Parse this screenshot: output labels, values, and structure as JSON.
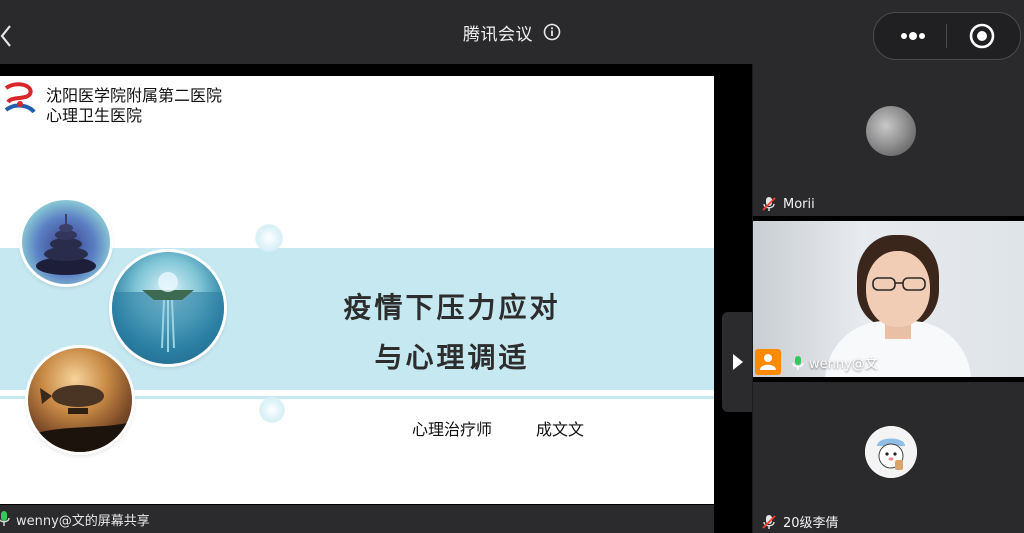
{
  "window": {
    "title": "腾讯会议"
  },
  "slide": {
    "hospital_line1": "沈阳医学院附属第二医院",
    "hospital_line2": "心理卫生医院",
    "title_line1": "疫情下压力应对",
    "title_line2": "与心理调适",
    "presenter_role": "心理治疗师",
    "presenter_name": "成文文"
  },
  "share_bar": {
    "label": "wenny@文的屏幕共享"
  },
  "participants": [
    {
      "name": "Morii",
      "muted": true
    },
    {
      "name": "wenny@文",
      "muted": false,
      "video": true
    },
    {
      "name": "20级李倩",
      "muted": true
    }
  ],
  "colors": {
    "band": "#c6e8f1",
    "muted_icon": "#ff3b30",
    "active_mic": "#34c759",
    "camera_badge": "#ff8a00"
  }
}
